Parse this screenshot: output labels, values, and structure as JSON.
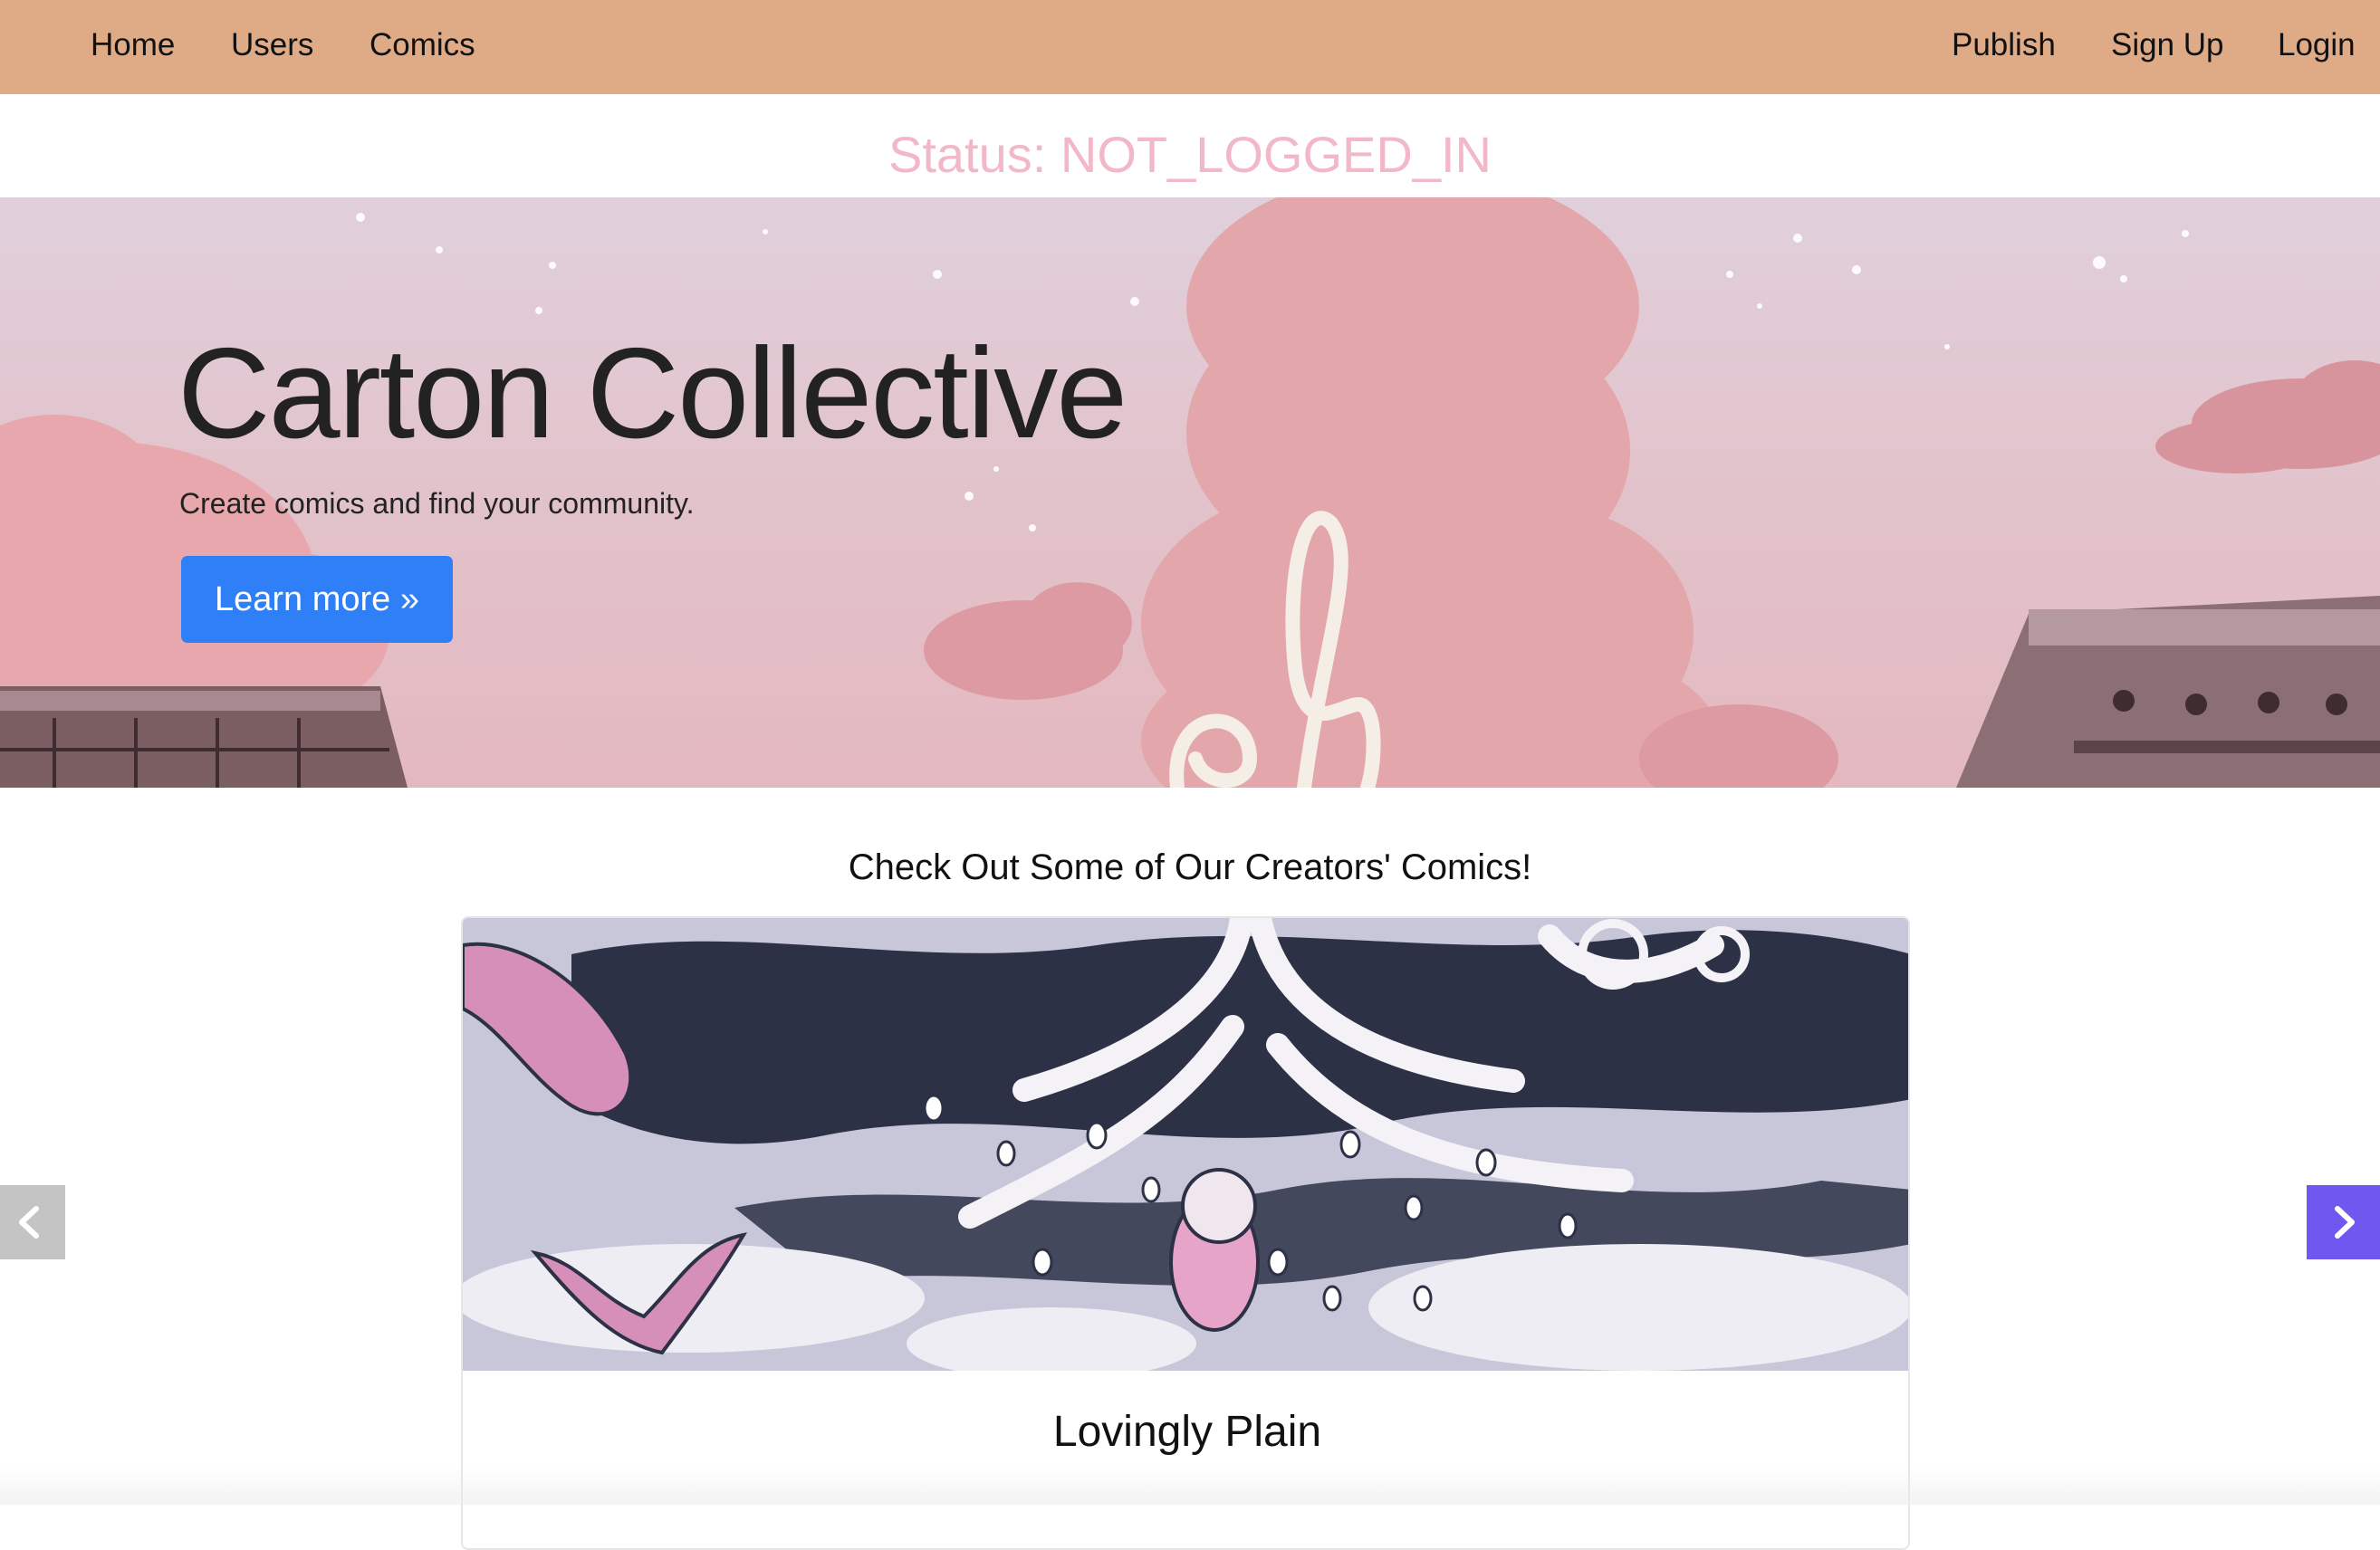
{
  "nav": {
    "home": "Home",
    "users": "Users",
    "comics": "Comics",
    "publish": "Publish",
    "signup": "Sign Up",
    "login": "Login"
  },
  "status": {
    "text": "Status: NOT_LOGGED_IN"
  },
  "hero": {
    "title": "Carton Collective",
    "subtitle": "Create comics and find your community.",
    "button": "Learn more »"
  },
  "comics": {
    "section_title": "Check Out Some of Our Creators' Comics!",
    "featured_title": "Lovingly Plain"
  },
  "carousel": {
    "prev_icon": "chevron-left-icon",
    "next_icon": "chevron-right-icon"
  },
  "colors": {
    "navbar": "#dfaa86",
    "status_text": "#f3b8c8",
    "button": "#2f7ff6",
    "next_arrow": "#7057f0",
    "prev_arrow": "#c4c4c4"
  }
}
